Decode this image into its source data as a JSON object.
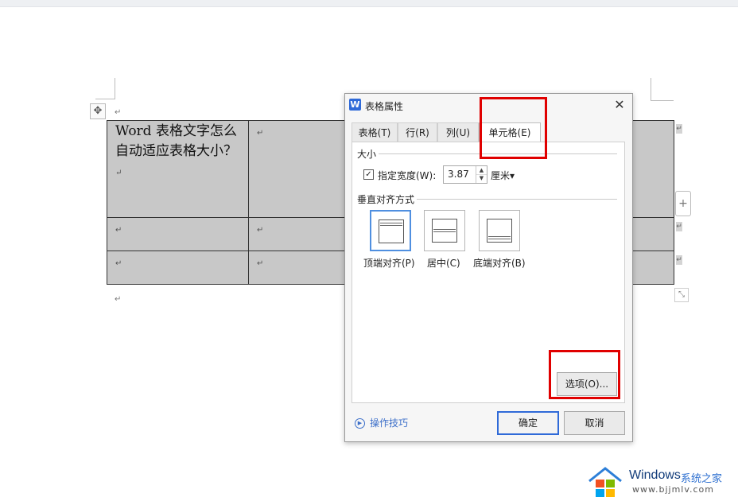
{
  "document": {
    "cell_text": "Word 表格文字怎么自动适应表格大小？",
    "paragraph_mark": "↵"
  },
  "dialog": {
    "title": "表格属性",
    "app_icon": "W",
    "close": "✕",
    "tabs": [
      "表格(T)",
      "行(R)",
      "列(U)",
      "单元格(E)"
    ],
    "active_tab": "单元格(E)",
    "size_section": "大小",
    "specify_width_checked": true,
    "specify_width_label": "指定宽度(W):",
    "width_value": "3.87",
    "width_unit": "厘米▾",
    "valign_section": "垂直对齐方式",
    "valign_options": [
      "顶端对齐(P)",
      "居中(C)",
      "底端对齐(B)"
    ],
    "valign_selected": "顶端对齐(P)",
    "options_button": "选项(O)...",
    "tips": "操作技巧",
    "ok": "确定",
    "cancel": "取消"
  },
  "icons": {
    "move": "move-handle-icon",
    "app": "wps-writer-icon",
    "close": "close-icon",
    "check": "checkbox-check-icon",
    "tips": "play-circle-icon"
  },
  "colors": {
    "highlight": "#e00000",
    "accent": "#2f6ad8",
    "cell_fill": "#c8c8c8"
  },
  "watermark": {
    "brand": "Windows",
    "name_cn": "系统之家",
    "url": "www.bjjmlv.com"
  }
}
